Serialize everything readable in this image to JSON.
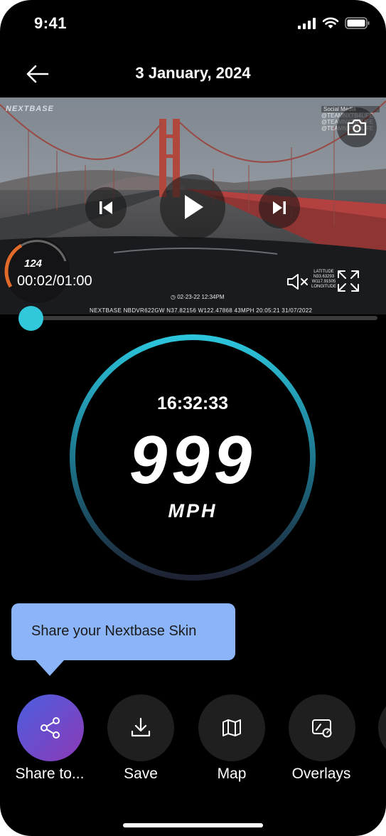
{
  "status_bar": {
    "time": "9:41"
  },
  "header": {
    "title": "3 January, 2024"
  },
  "video": {
    "watermark": "NEXTBASE",
    "social_heading": "Social Media",
    "social_lines": [
      "@TEAMNXTB4LIFE",
      "@TEAMNXTB4LIFE",
      "@TEAMNXTB4LIFE"
    ],
    "overlay_speed": "124",
    "elapsed": "00:02/01:00",
    "date_stamp": "02-23-22  12:34PM",
    "info_strip": "NEXTBASE   NBDVR622GW     N37.82156  W122.47868   43MPH   20:05:21  31/07/2022",
    "lat_label": "LATITUDE",
    "lat_value": "N33.63293",
    "lon_value": "W117.91505",
    "lon_label": "LONGITUDE",
    "progress_fraction": 0.03
  },
  "gauge": {
    "time": "16:32:33",
    "speed": "999",
    "unit": "MPH"
  },
  "tooltip": {
    "text": "Share your Nextbase Skin"
  },
  "actions": [
    {
      "label": "Share to...",
      "icon": "share-icon"
    },
    {
      "label": "Save",
      "icon": "download-icon"
    },
    {
      "label": "Map",
      "icon": "map-icon"
    },
    {
      "label": "Overlays",
      "icon": "overlays-icon"
    }
  ],
  "colors": {
    "accent": "#31c8dc",
    "tooltip": "#8bb4f9",
    "share_gradient_start": "#4a5fe0",
    "share_gradient_end": "#8e39b6"
  }
}
